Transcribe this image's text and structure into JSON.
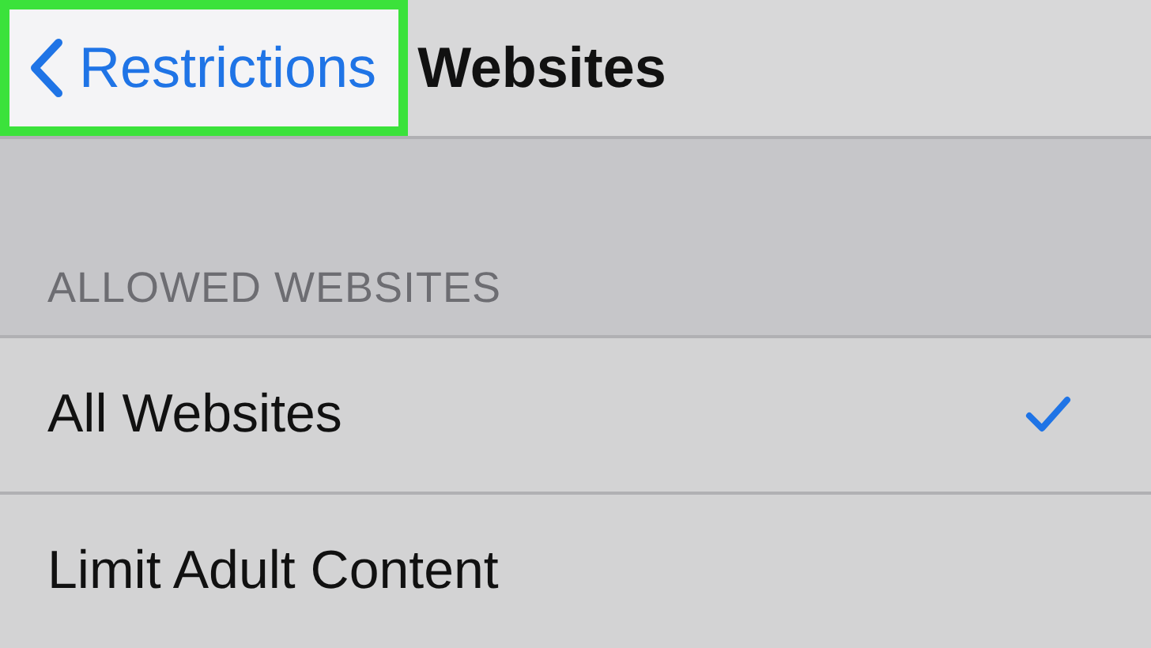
{
  "nav_bar": {
    "back_label": "Restrictions",
    "title": "Websites",
    "back_highlighted": true
  },
  "section": {
    "header": "ALLOWED WEBSITES"
  },
  "rows": [
    {
      "label": "All Websites",
      "selected": true
    },
    {
      "label": "Limit Adult Content",
      "selected": false
    }
  ]
}
